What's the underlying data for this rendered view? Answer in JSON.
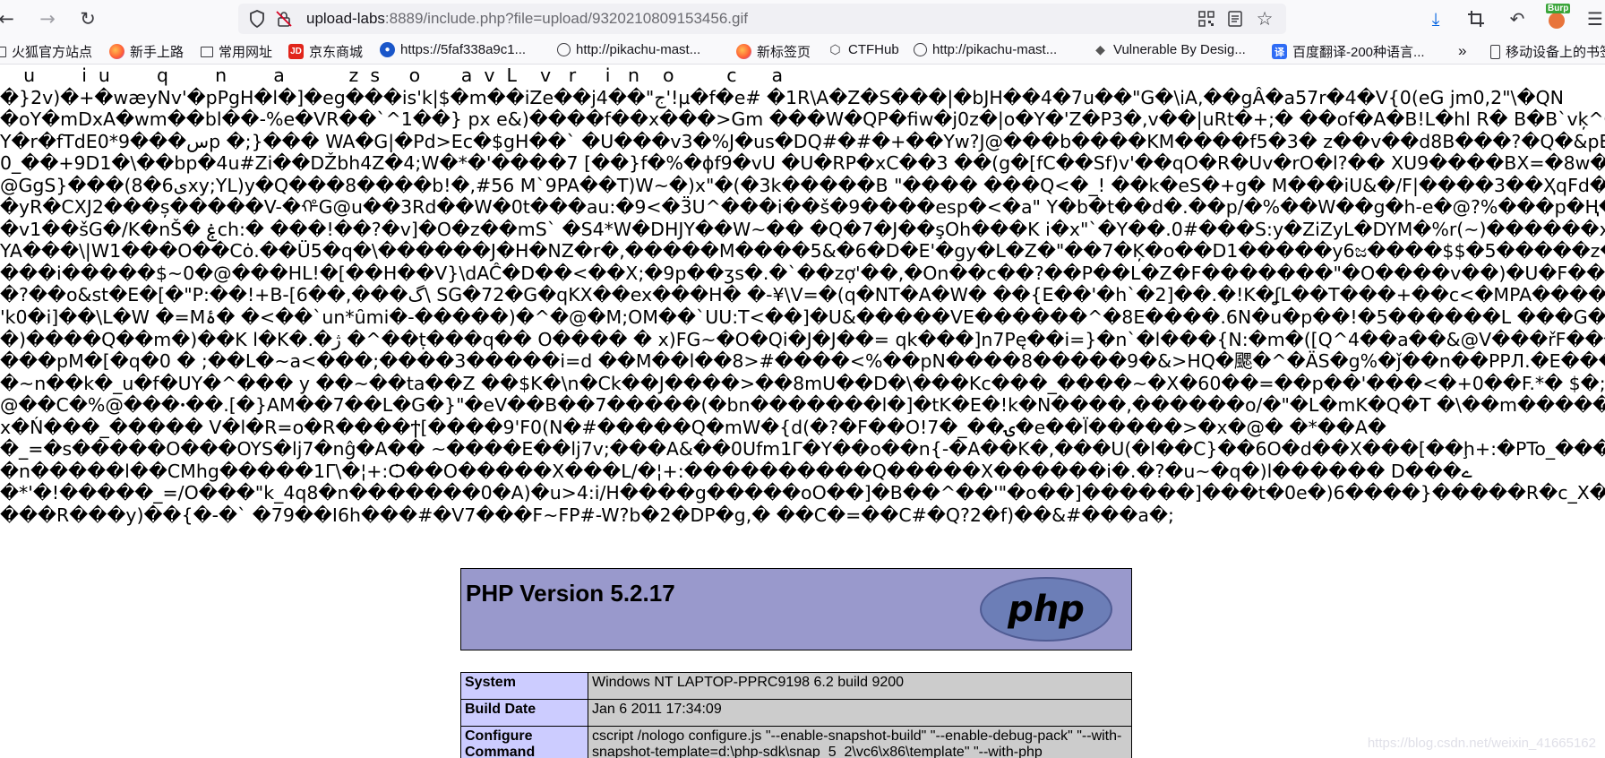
{
  "browser": {
    "url_host": "upload-labs",
    "url_rest": ":8889/include.php?file=upload/9320210809153456.gif",
    "burp_label": "Burp"
  },
  "bookmarks": [
    {
      "label": "火狐官方站点",
      "icon": "folder-icon"
    },
    {
      "label": "新手上路",
      "icon": "firefox-icon"
    },
    {
      "label": "常用网址",
      "icon": "folder-icon"
    },
    {
      "label": "京东商城",
      "icon": "jd-icon"
    },
    {
      "label": "https://5faf338a9c1...",
      "icon": "globe-icon"
    },
    {
      "label": "http://pikachu-mast...",
      "icon": "globe-icon"
    },
    {
      "label": "新标签页",
      "icon": "firefox-icon"
    },
    {
      "label": "CTFHub",
      "icon": "ctfhub-icon"
    },
    {
      "label": "http://pikachu-mast...",
      "icon": "globe-icon"
    },
    {
      "label": "Vulnerable By Desig...",
      "icon": "vulnhub-icon"
    },
    {
      "label": "百度翻译-200种语言...",
      "icon": "baidu-translate-icon"
    },
    {
      "label": "移动设备上的书签",
      "icon": "mobile-icon"
    }
  ],
  "garbage_lines": [
    "    u        i  u        q        n        a           z  s     o       a  v  L    v   r     i   n    o         c      a",
    "�}2v)�+�wæyNv'�pPgH�l�]�eg���is'k|$�m��iZe��j4��\"ج'!µ�f�e# �1R\\A�Z�S���|�bJH��4�7u��\"G�\\iA,��gÂ�a57r�4�V{0(eG jm0,2\"\\�QN",
    "�oY�mDxA�wm��bl��-%e�VR��`^1��} px e&)����f��x���>Gm ���W�QP�fiw�j0z�|o�Y�'Z�P3�,v��|uRt�+;� ��of�A�B!L�hl R� B�B`vķ^Gw_A��#+",
    "Y�r�fTdE0*9���سp �;}��� WA�G|�Pd>Ec�$gH��` �U���v3�%J�us�DQ#�#�+��Yw?J@���b����KM����f5�3� z��v��d8B���?�Q�&pE��T<+ �SR��",
    "0_��+9D1�\\��bp�4u#Zi��DŽbh4Z�4;W�*�'����7 [��}f�%�ϕf9�vU �U�RP�xC��3 ��(g�[fC��Sf)v'��qO�R�Uv�rO�l?�� XU9����BX=�8w�\"g�4�b��S�",
    "@GgS}���(8�6یxy;YL)y�Q���8����b!�,#56 M`9PA��T)W~�)x\"�(�3k�����B \"���� ���Q<�_! ��k�eS�+g� M���iU&�/F|����3��ҲqFd���O���E�ە",
    "�yR�CXJ2���ș�����V-�ᡥG@u��3Rd��W�0t���au:�9<�3̈U^���i��š�9����esp�<�a\" Y�b�t��d�.��p/�%��W��g�h-e�@?%���p�Ⱨ��#�",
    "�v1��šG�/K�nŠ� ۼch:� ���!��?�v]�O�z��mS` �S4*W�DHJY��W~�� �Q�7�J��şOh���K i�x\"`�Y��.0#���S:y�ZiZyL�DYM�%r(~)������xC�",
    "YA���\\|W1���O��Cȯ.��Ü5�q�\\������J�H�NZ�r�,�����M����5&�6�D�E'�gy�L�Z�\"��7�Ķ�o��D1�����y6ಜ����$$�5�����z�Y �}",
    "���i�����$~0�@���HL!�[��H��V}\\dAĈ�D��<��X;�9p��ʒs�.�`��zợ'��,�On��c��?��P��L�Z�F�������\"�O����v��)�U�F��D���uT�1ⁱlq",
    "�?��o&st�E�[�\"P:��!+B-[6��,���گ\\ SG�72�G�qKX��ex���H� �-¥\\V=�(q�NT�A�W� ��{E��'�h`�2]��.�!K�ʆL��T���+��c<�MPA�����R)'����!",
    "'k0�i]��\\L�W �=Mۂ� �<��`un*ȗmi�-�����)�^�@�M;OM��`UU:T<��]�U&�����VE������^�8E����.6N�u�p��!�5������L ���G��5�] ���]Av",
    "�)����Q��m�)��K l�K�.�ﮊ �^��ṭ���q�� O���� � x)FG~�O�Qi�J�J��= qk���]n7Pę��i=}�n`�l���{N:�m�([Q^4��a��&@V���řF���M���",
    "���pM�[�q�0 � ;��L�~a<���;����3�����i=d ��M��l��8>#����<%��pN����8�����9�&>HQ�颸�^�ÄS�g%�ǰ��n��PPЛ.�E����M�C�\"�%Z",
    "�~n��k�_u�f�UY�^��� y ��~��ta��Z ��$K�\\n�Ck��J����>��8mU��D�\\���Kc���_����~�X�60��=��p��'���<�+0��F.*� $�;H",
    "@��C�%@���ꞏ��.[�}AM��7��L�G�}\"�eV��B��7�����(�bn�������l�]�tK�E�!k�N����,������o/�\"�L�mK�Q�T �\\��m�����#~�PO����",
    "x�Ń���_����� V�l�R=o�R����ϯ[����9'F0(N�#�����Q�mW�{d(�?�F��O!7�_��ۍ�e��l̈�����>�x�@� �*��A�",
    "�_=�s�����O���OYS�lj7�nĝ�A�� ~����E��lj7v;���A&��0Ufm1Γ�Y��o��n{-�A��K�,���U(�l��C}��6O�d��X���[��ḩ+:�PTo_���",
    "�n�����l��CMhg�����1Γ\\�¦+:Ѻ��O�����X���L/�¦+:����������Q�����X������i�.�?�u~�q�)l������ D���ے",
    "�*'�!�����_=/O���\"k_4q8�n�������0�A)�u>4:i/H����g�����oO��]�B��^��'\"�o��]������]���t�0e�)6����}�����R�c_X�,�?%����3�",
    "���R���y)��{�-�` �79��I6h���#�V7���F~FP#-W?b�2�DP�g,� ��C�=��C#�Q?2�f)��&#���a�;"
  ],
  "phpinfo": {
    "version_title": "PHP Version 5.2.17",
    "logo_text": "php",
    "rows": [
      {
        "key": "System",
        "value": "Windows NT LAPTOP-PPRC9198 6.2 build 9200"
      },
      {
        "key": "Build Date",
        "value": "Jan 6 2011 17:34:09"
      },
      {
        "key": "Configure Command",
        "value": "cscript /nologo configure.js \"--enable-snapshot-build\" \"--enable-debug-pack\" \"--with-snapshot-template=d:\\php-sdk\\snap_5_2\\vc6\\x86\\template\" \"--with-php"
      }
    ]
  },
  "watermark": "https://blog.csdn.net/weixin_41665162",
  "colors": {
    "php_header": "#9999cc",
    "php_key": "#ccccff",
    "php_value": "#cccccc"
  }
}
